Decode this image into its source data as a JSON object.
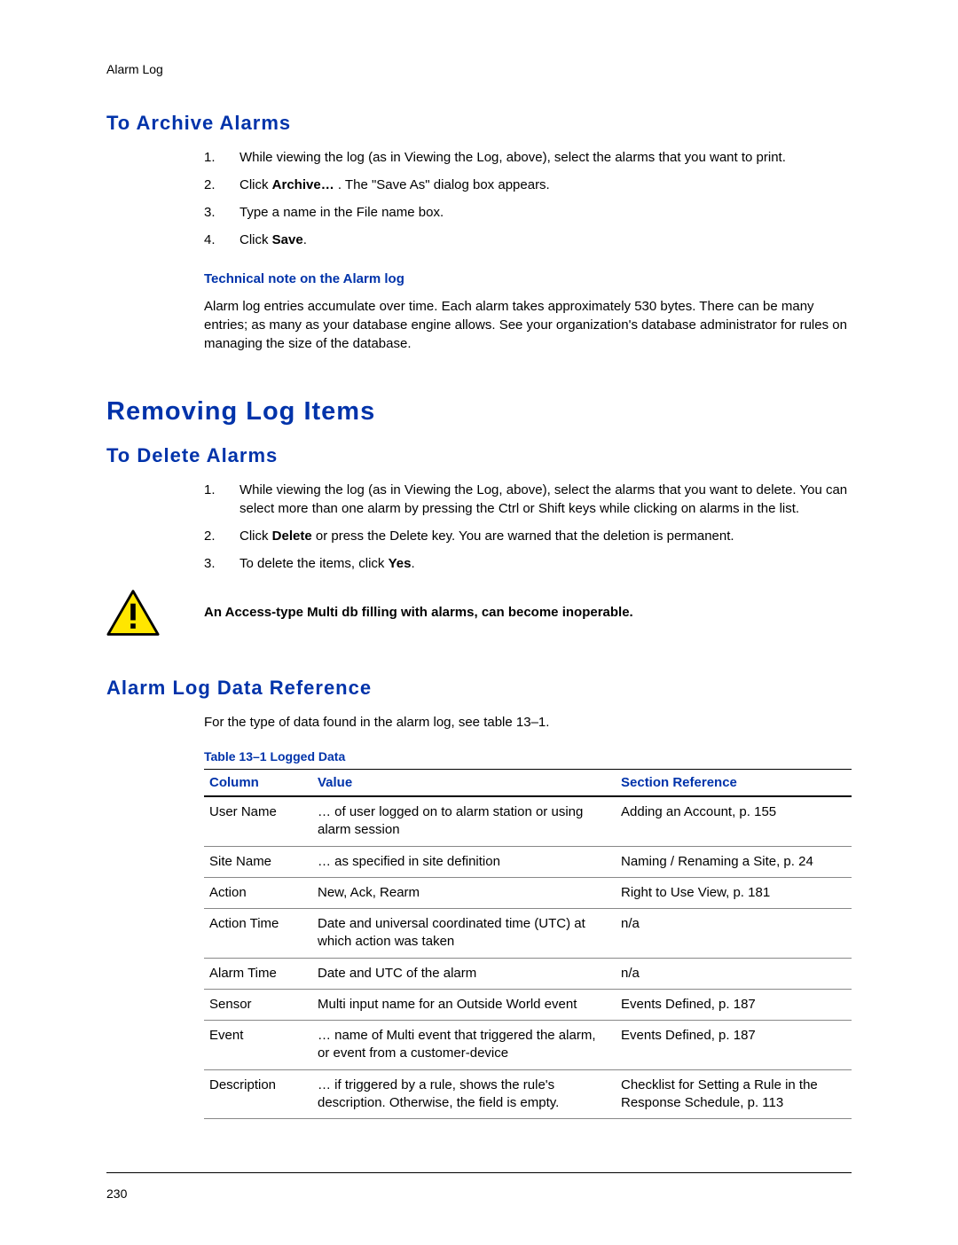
{
  "header": {
    "label": "Alarm Log"
  },
  "sections": {
    "archive": {
      "title": "To Archive Alarms",
      "steps": [
        {
          "n": "1.",
          "t": "While viewing the log (as in Viewing the Log, above), select the alarms that you want to print."
        },
        {
          "n": "2.",
          "t_pre": "Click ",
          "t_bold": "Archive…",
          "t_post": " . The \"Save As\" dialog box appears."
        },
        {
          "n": "3.",
          "t": "Type a name in the File name box."
        },
        {
          "n": "4.",
          "t_pre": "Click ",
          "t_bold": "Save",
          "t_post": "."
        }
      ],
      "note_title": "Technical note on the Alarm log",
      "note_body": "Alarm log entries accumulate over time. Each alarm takes approximately 530 bytes. There can be many entries; as many as your database engine allows. See your organization's database administrator for rules on managing the size of the database."
    },
    "removing": {
      "title": "Removing Log Items"
    },
    "delete": {
      "title": "To Delete Alarms",
      "steps": [
        {
          "n": "1.",
          "t": "While viewing the log (as in Viewing the Log, above), select the alarms that you want to delete. You can select more than one alarm by pressing the Ctrl or Shift keys while clicking on alarms in the list."
        },
        {
          "n": "2.",
          "t_pre": "Click ",
          "t_bold": "Delete",
          "t_post": " or press the Delete key. You are warned that the deletion is permanent."
        },
        {
          "n": "3.",
          "t_pre": "To delete the items, click ",
          "t_bold": "Yes",
          "t_post": "."
        }
      ],
      "warning": "An Access-type Multi db filling with alarms, can become inoperable."
    },
    "reference": {
      "title": "Alarm Log Data Reference",
      "intro": "For the type of data found in the alarm log, see table 13–1.",
      "table_caption": "Table 13–1  Logged Data",
      "headers": {
        "c1": "Column",
        "c2": "Value",
        "c3": "Section Reference"
      },
      "rows": [
        {
          "c1": "User Name",
          "c2": "… of user logged on to alarm station or using alarm session",
          "c3": "Adding an Account, p. 155"
        },
        {
          "c1": "Site Name",
          "c2": "… as specified in site definition",
          "c3": "Naming / Renaming a Site, p. 24"
        },
        {
          "c1": "Action",
          "c2": "New, Ack, Rearm",
          "c3": "Right to Use View, p. 181"
        },
        {
          "c1": "Action Time",
          "c2": "Date and universal coordinated time (UTC) at which action was taken",
          "c3": "n/a"
        },
        {
          "c1": "Alarm Time",
          "c2": "Date and UTC of the alarm",
          "c3": "n/a"
        },
        {
          "c1": "Sensor",
          "c2": "Multi input name for an Outside World event",
          "c3": "Events Defined, p. 187"
        },
        {
          "c1": "Event",
          "c2": "… name of Multi event that triggered the alarm, or event from a customer-device",
          "c3": "Events Defined, p. 187"
        },
        {
          "c1": "Description",
          "c2": "… if triggered by a rule, shows the rule's description. Otherwise, the field is empty.",
          "c3": "Checklist for Setting a Rule in the Response Schedule, p. 113"
        }
      ]
    }
  },
  "footer": {
    "page": "230"
  }
}
